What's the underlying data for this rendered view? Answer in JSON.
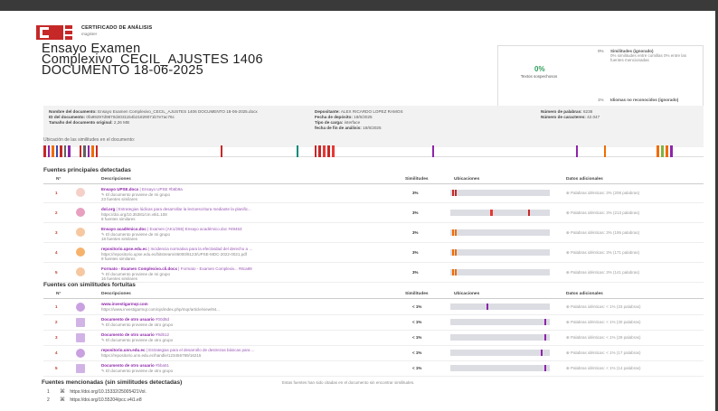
{
  "header": {
    "cert_title": "CERTIFICADO DE ANÁLISIS",
    "cert_sub": "magister",
    "doc_title_line1": "Ensayo Examen",
    "doc_title_line2": "Complexivo_CECIL_AJUSTES 1406",
    "doc_title_line3": "DOCUMENTO 18-06-2025"
  },
  "summary": {
    "percent": "0%",
    "percent_label": "Textos sospechosos",
    "side1_key": "0%",
    "side1_title": "Similitudes (ignorado)",
    "side1_text": "0% similitudes entre comillas 0% entre las fuentes mencionadas",
    "side2_key": "1%",
    "side2_title": "Idiomas no reconocidos (ignorado)"
  },
  "meta": {
    "doc_name_label": "Nombre del documento:",
    "doc_name": "Ensayo Examen Complexivo_CECIL_AJUSTES 1406 DOCUMENTO 18-06-2025.docx",
    "doc_id_label": "ID del documento:",
    "doc_id": "0fa99297d9870d4031154b21829071b7e7ac76c",
    "size_label": "Tamaño del documento original:",
    "size": "2,26 MB",
    "depositor_label": "Depositante:",
    "depositor": "ALEX RICARDO LOPEZ RAMOS",
    "deposit_date_label": "Fecha de depósito:",
    "deposit_date": "18/6/2025",
    "load_type_label": "Tipo de carga:",
    "load_type": "interface",
    "end_date_label": "fecha de fin de análisis:",
    "end_date": "18/6/2025",
    "words_label": "Número de palabras:",
    "words": "6238",
    "chars_label": "Número de caracteres:",
    "chars": "42.047"
  },
  "strip_label": "Ubicación de las similitudes en el documento:",
  "main_sources": {
    "title": "Fuentes principales detectadas",
    "headers": [
      "N°",
      "Descripciones",
      "Similitudes",
      "Ubicaciones",
      "Datos adicionales"
    ],
    "rows": [
      {
        "num": "1",
        "name": "Ensayo UPSE.docx",
        "rest": "| Ensayo UPSE  #b6b9a",
        "line2": "✎ El documento proviene de mi grupo",
        "line3": "23 fuentes similares",
        "sim": "3%",
        "extra": "⊕ Palabras idénticas: 3% (208 palabras)"
      },
      {
        "num": "2",
        "name": "dol.org",
        "rest": "| Estrategias lúdicas para desarrollar la lectoescritura mediante la planific...",
        "line2": "https://doi.org/10.35381/cm.v8i1.108",
        "line3": "8 fuentes similares",
        "sim": "3%",
        "extra": "⊕ Palabras idénticas: 3% (213 palabras)"
      },
      {
        "num": "3",
        "name": "Ensayo académico.doc",
        "rest": "| Examen (AK1/255) Ensayo académico.doc  #49463",
        "line2": "✎ El documento proviene de mi grupo",
        "line3": "18 fuentes similares",
        "sim": "3%",
        "extra": "⊕ Palabras idénticas: 3% (195 palabras)"
      },
      {
        "num": "4",
        "name": "repositorio.upse.edu.ec",
        "rest": "| Incidencia normativa para la efectividad del derecho a ...",
        "line2": "https://repositorio.upse.edu.ec/bitstream/46000/8123/UPSE-MDC-2022-0021.pdf",
        "line3": "9 fuentes similares",
        "sim": "3%",
        "extra": "⊕ Palabras idénticas: 3% (171 palabras)"
      },
      {
        "num": "5",
        "name": "Formato - Examen Complexivo.cli.docx",
        "rest": "| Formato - Examen Complexiv...  #8ca89",
        "line2": "✎ El documento proviene de mi grupo",
        "line3": "16 fuentes similares",
        "sim": "3%",
        "extra": "⊕ Palabras idénticas: 3% (141 palabras)"
      }
    ]
  },
  "fortuitous_sources": {
    "title": "Fuentes con similitudes fortuitas",
    "headers": [
      "N°",
      "Descripciones",
      "Similitudes",
      "Ubicaciones",
      "Datos adicionales"
    ],
    "rows": [
      {
        "num": "1",
        "name": "www.investigarmqr.com",
        "rest": "",
        "line2": "https://www.investigarmqr.com/ojs/index.php/mqr/article/view/94...",
        "sim": "< 1%",
        "extra": "⊕ Palabras idénticas: < 1% (33 palabras)"
      },
      {
        "num": "2",
        "name": "Documento de otro usuario",
        "rest": "#00d8d",
        "line2": "✎ El documento proviene de otro grupo",
        "sim": "< 1%",
        "extra": "⊕ Palabras idénticas: < 1% (30 palabras)"
      },
      {
        "num": "3",
        "name": "Documento de otro usuario",
        "rest": "#9d512",
        "line2": "✎ El documento proviene de otro grupo",
        "sim": "< 1%",
        "extra": "⊕ Palabras idénticas: < 1% (29 palabras)"
      },
      {
        "num": "4",
        "name": "repositorio.unn.edu.ec",
        "rest": "| Estrategias para el desarrollo de destrezas básicas para ...",
        "line2": "https://repositorio.unn.edu.ec/handle/123456789/16215",
        "sim": "< 1%",
        "extra": "⊕ Palabras idénticas: < 1% (17 palabras)"
      },
      {
        "num": "5",
        "name": "Documento de otro usuario",
        "rest": "#bba51",
        "line2": "✎ El documento proviene de otro grupo",
        "sim": "< 1%",
        "extra": "⊕ Palabras idénticas: < 1% (14 palabras)"
      }
    ]
  },
  "mentioned": {
    "title": "Fuentes mencionadas (sin similitudes detectadas)",
    "note": "Estas fuentes han sido citadas en el documento sin encontrar similitudes.",
    "items": [
      {
        "num": "1",
        "url": "https://doi.org/10.15332/25005421Vol."
      },
      {
        "num": "2",
        "url": "https://doi.org/10.55204/pcc.v4i1.e8"
      }
    ]
  },
  "colors": {
    "accent_red": "#c62828",
    "purple": "#8e24aa",
    "green": "#2e9e5b",
    "orange": "#ef6c00"
  }
}
